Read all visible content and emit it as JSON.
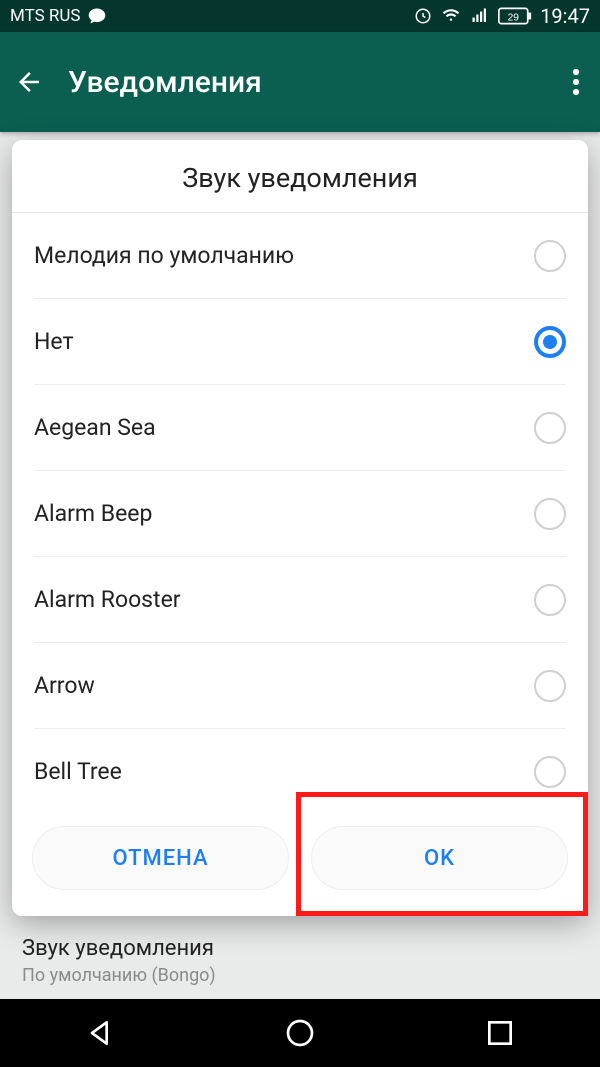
{
  "statusbar": {
    "carrier": "MTS RUS",
    "battery": "29",
    "time": "19:47"
  },
  "appbar": {
    "title": "Уведомления"
  },
  "dialog": {
    "title": "Звук уведомления",
    "options": [
      {
        "label": "Мелодия по умолчанию",
        "selected": false
      },
      {
        "label": "Нет",
        "selected": true
      },
      {
        "label": "Aegean Sea",
        "selected": false
      },
      {
        "label": "Alarm Beep",
        "selected": false
      },
      {
        "label": "Alarm Rooster",
        "selected": false
      },
      {
        "label": "Arrow",
        "selected": false
      },
      {
        "label": "Bell Tree",
        "selected": false
      }
    ],
    "cancel": "ОТМЕНА",
    "ok": "OK"
  },
  "background_setting": {
    "title": "Звук уведомления",
    "subtitle": "По умолчанию (Bongo)"
  }
}
